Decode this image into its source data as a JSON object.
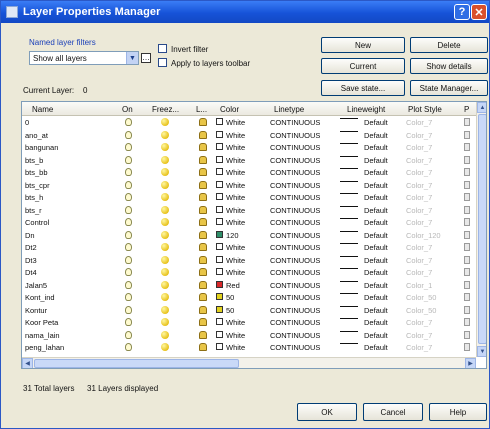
{
  "window": {
    "title": "Layer Properties Manager",
    "help_glyph": "?",
    "close_glyph": "✕"
  },
  "filters": {
    "group_label": "Named layer filters",
    "selected": "Show all layers",
    "invert_label": "Invert filter",
    "apply_label": "Apply to layers toolbar"
  },
  "buttons": {
    "new": "New",
    "delete": "Delete",
    "current": "Current",
    "show_details": "Show details",
    "save_state": "Save state...",
    "state_manager": "State Manager...",
    "ok": "OK",
    "cancel": "Cancel",
    "help": "Help"
  },
  "current_layer": {
    "label": "Current Layer:",
    "value": "0"
  },
  "columns": {
    "name": "Name",
    "on": "On",
    "freeze": "Freez...",
    "lock": "L...",
    "color": "Color",
    "linetype": "Linetype",
    "lineweight": "Lineweight",
    "plot_style": "Plot Style",
    "plot": "P"
  },
  "rows": [
    {
      "name": "0",
      "color": "White",
      "swatch": "#ffffff",
      "linetype": "CONTINUOUS",
      "lineweight": "Default",
      "plot_style": "Color_7"
    },
    {
      "name": "ano_at",
      "color": "White",
      "swatch": "#ffffff",
      "linetype": "CONTINUOUS",
      "lineweight": "Default",
      "plot_style": "Color_7"
    },
    {
      "name": "bangunan",
      "color": "White",
      "swatch": "#ffffff",
      "linetype": "CONTINUOUS",
      "lineweight": "Default",
      "plot_style": "Color_7"
    },
    {
      "name": "bts_b",
      "color": "White",
      "swatch": "#ffffff",
      "linetype": "CONTINUOUS",
      "lineweight": "Default",
      "plot_style": "Color_7"
    },
    {
      "name": "bts_bb",
      "color": "White",
      "swatch": "#ffffff",
      "linetype": "CONTINUOUS",
      "lineweight": "Default",
      "plot_style": "Color_7"
    },
    {
      "name": "bts_cpr",
      "color": "White",
      "swatch": "#ffffff",
      "linetype": "CONTINUOUS",
      "lineweight": "Default",
      "plot_style": "Color_7"
    },
    {
      "name": "bts_h",
      "color": "White",
      "swatch": "#ffffff",
      "linetype": "CONTINUOUS",
      "lineweight": "Default",
      "plot_style": "Color_7"
    },
    {
      "name": "bts_r",
      "color": "White",
      "swatch": "#ffffff",
      "linetype": "CONTINUOUS",
      "lineweight": "Default",
      "plot_style": "Color_7"
    },
    {
      "name": "Control",
      "color": "White",
      "swatch": "#ffffff",
      "linetype": "CONTINUOUS",
      "lineweight": "Default",
      "plot_style": "Color_7"
    },
    {
      "name": "Dn",
      "color": "120",
      "swatch": "#2f8f6a",
      "linetype": "CONTINUOUS",
      "lineweight": "Default",
      "plot_style": "Color_120"
    },
    {
      "name": "Dt2",
      "color": "White",
      "swatch": "#ffffff",
      "linetype": "CONTINUOUS",
      "lineweight": "Default",
      "plot_style": "Color_7"
    },
    {
      "name": "Dt3",
      "color": "White",
      "swatch": "#ffffff",
      "linetype": "CONTINUOUS",
      "lineweight": "Default",
      "plot_style": "Color_7"
    },
    {
      "name": "Dt4",
      "color": "White",
      "swatch": "#ffffff",
      "linetype": "CONTINUOUS",
      "lineweight": "Default",
      "plot_style": "Color_7"
    },
    {
      "name": "Jalan5",
      "color": "Red",
      "swatch": "#d9282a",
      "linetype": "CONTINUOUS",
      "lineweight": "Default",
      "plot_style": "Color_1"
    },
    {
      "name": "Kont_ind",
      "color": "50",
      "swatch": "#e2d21e",
      "linetype": "CONTINUOUS",
      "lineweight": "Default",
      "plot_style": "Color_50"
    },
    {
      "name": "Kontur",
      "color": "50",
      "swatch": "#e2d21e",
      "linetype": "CONTINUOUS",
      "lineweight": "Default",
      "plot_style": "Color_50"
    },
    {
      "name": "Koor Peta",
      "color": "White",
      "swatch": "#ffffff",
      "linetype": "CONTINUOUS",
      "lineweight": "Default",
      "plot_style": "Color_7"
    },
    {
      "name": "nama_lain",
      "color": "White",
      "swatch": "#ffffff",
      "linetype": "CONTINUOUS",
      "lineweight": "Default",
      "plot_style": "Color_7"
    },
    {
      "name": "peng_lahan",
      "color": "White",
      "swatch": "#ffffff",
      "linetype": "CONTINUOUS",
      "lineweight": "Default",
      "plot_style": "Color_7"
    }
  ],
  "status": {
    "total": "31 Total layers",
    "displayed": "31 Layers displayed"
  },
  "scroll": {
    "up": "▲",
    "down": "▼",
    "left": "◀",
    "right": "▶",
    "dropdown": "▼"
  }
}
